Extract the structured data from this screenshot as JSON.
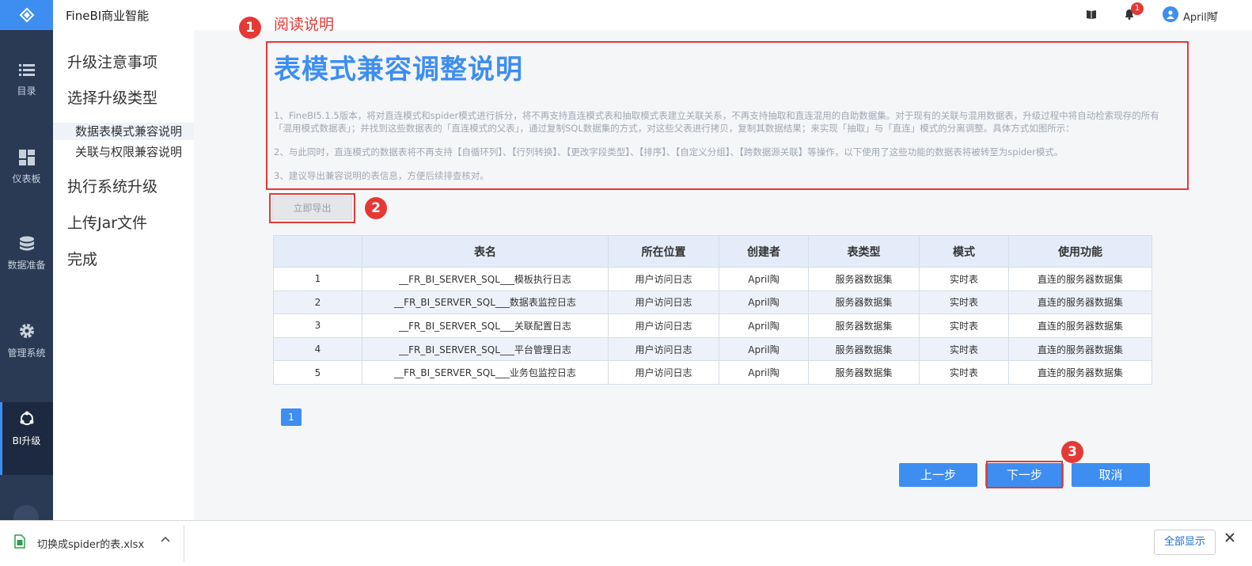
{
  "app": {
    "title": "FineBI商业智能"
  },
  "leftnav": {
    "items": [
      {
        "label": "目录",
        "icon": "list-icon"
      },
      {
        "label": "仪表板",
        "icon": "dashboard-icon"
      },
      {
        "label": "数据准备",
        "icon": "database-icon"
      },
      {
        "label": "管理系统",
        "icon": "gear-icon"
      },
      {
        "label": "BI升级",
        "icon": "upgrade-icon",
        "active": true
      }
    ]
  },
  "topbar": {
    "notification_count": "1",
    "user_name": "April陶",
    "user_caret": "▾"
  },
  "steps": {
    "items": [
      "升级注意事项",
      "选择升级类型",
      "数据表模式兼容说明",
      "关联与权限兼容说明",
      "执行系统升级",
      "上传Jar文件",
      "完成"
    ]
  },
  "annotations": {
    "one": "1",
    "two": "2",
    "three": "3",
    "read_note": "阅读说明"
  },
  "notice": {
    "title": "表模式兼容调整说明",
    "p1_line1": "1、FineBI5.1.5版本，将对直连模式和spider模式进行拆分，将不再支持直连模式表和抽取模式表建立关联关系，不再支持抽取和直连混用的自助数据集。对于现有的关联与混用数据表，升级过程中将自动检索现存的所有",
    "p1_line2": "「混用模式数据表」；并找到这些数据表的「直连模式的父表」，通过复制SQL数据集的方式，对这些父表进行拷贝，复制其数据结果；来实现「抽取」与「直连」模式的分离调整。具体方式如图所示：",
    "p2": "2、与此同时，直连模式的数据表将不再支持【自循环列】、【行列转换】、【更改字段类型】、【排序】、【自定义分组】、【跨数据源关联】等操作，以下使用了这些功能的数据表将被转至为spider模式。",
    "p3": "3、建议导出兼容说明的表信息，方便后续排查核对。"
  },
  "export_button": "立即导出",
  "table": {
    "headers": [
      "",
      "表名",
      "所在位置",
      "创建者",
      "表类型",
      "模式",
      "使用功能"
    ],
    "rows": [
      [
        "1",
        "__FR_BI_SERVER_SQL___模板执行日志",
        "用户访问日志",
        "April陶",
        "服务器数据集",
        "实时表",
        "直连的服务器数据集"
      ],
      [
        "2",
        "__FR_BI_SERVER_SQL___数据表监控日志",
        "用户访问日志",
        "April陶",
        "服务器数据集",
        "实时表",
        "直连的服务器数据集"
      ],
      [
        "3",
        "__FR_BI_SERVER_SQL___关联配置日志",
        "用户访问日志",
        "April陶",
        "服务器数据集",
        "实时表",
        "直连的服务器数据集"
      ],
      [
        "4",
        "__FR_BI_SERVER_SQL___平台管理日志",
        "用户访问日志",
        "April陶",
        "服务器数据集",
        "实时表",
        "直连的服务器数据集"
      ],
      [
        "5",
        "__FR_BI_SERVER_SQL___业务包监控日志",
        "用户访问日志",
        "April陶",
        "服务器数据集",
        "实时表",
        "直连的服务器数据集"
      ]
    ]
  },
  "pagination": {
    "current": "1"
  },
  "actions": {
    "prev": "上一步",
    "next": "下一步",
    "cancel": "取消"
  },
  "download_bar": {
    "filename": "切换成spider的表.xlsx",
    "show_all": "全部显示"
  },
  "colors": {
    "accent": "#3d8ef0",
    "annotation": "#e53935",
    "nav_bg": "#2a3a55"
  }
}
